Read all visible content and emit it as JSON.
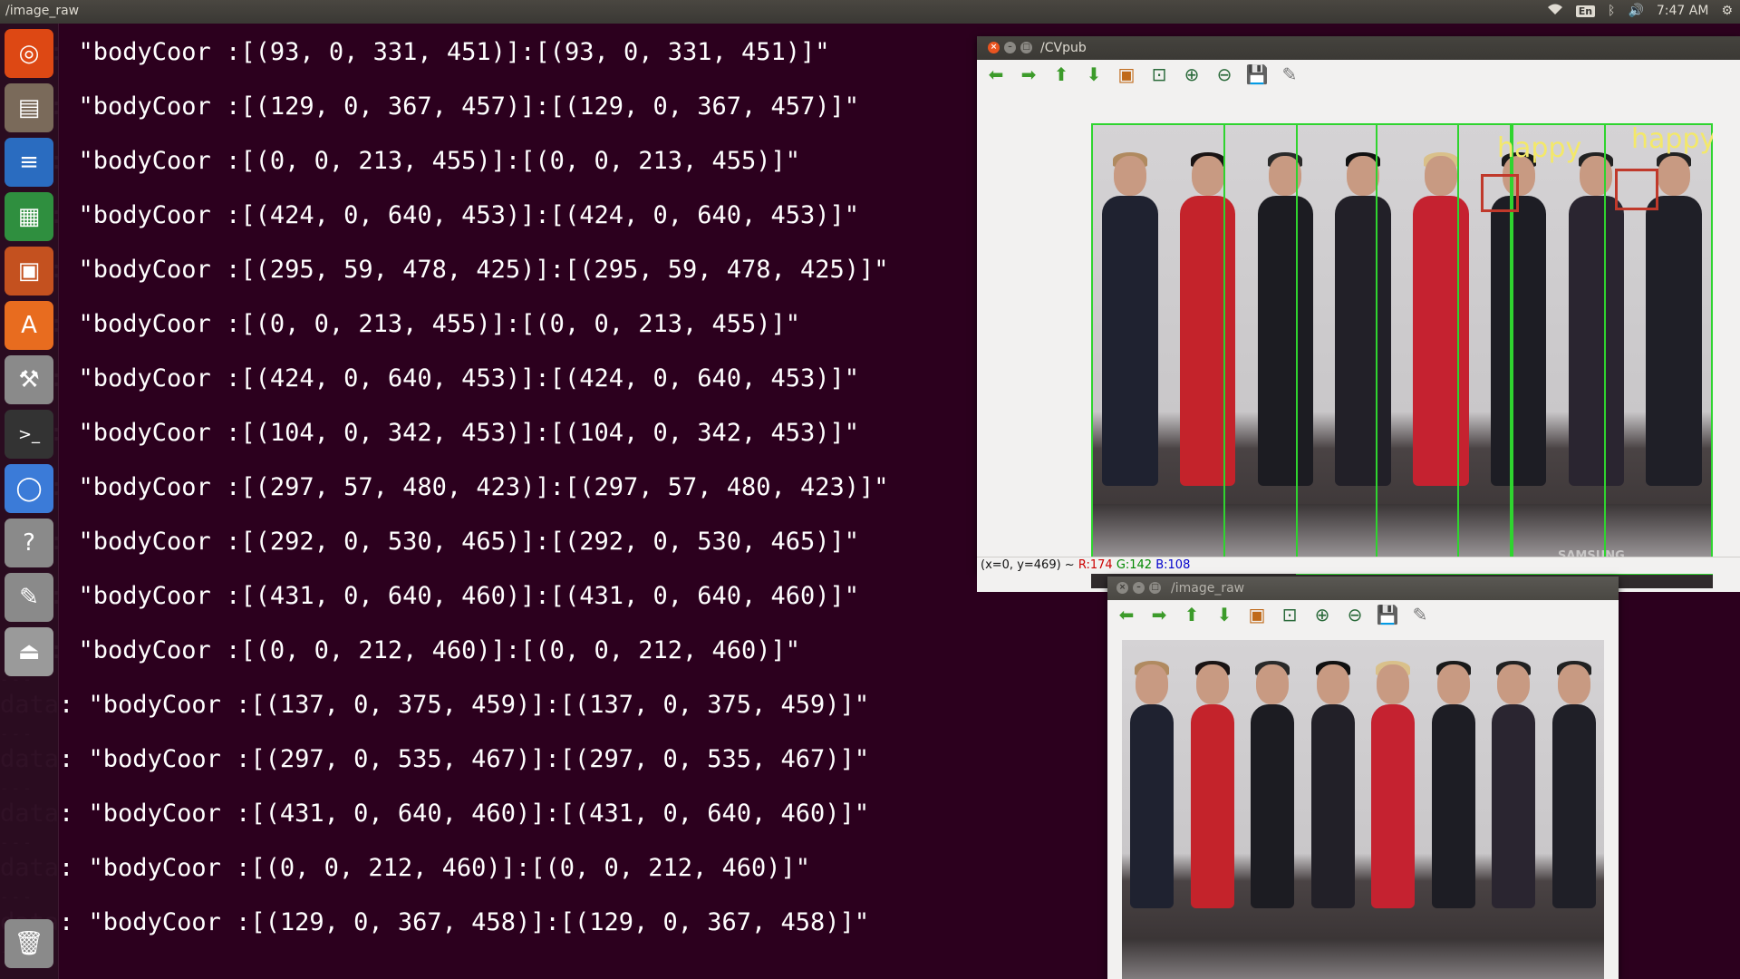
{
  "topbar": {
    "title": "/image_raw",
    "keyboard": "En",
    "time": "7:47 AM"
  },
  "launcher": {
    "items": [
      {
        "icon": "ubuntu-dash-icon",
        "color": "#dd4814"
      },
      {
        "icon": "files-icon",
        "color": "#7a6a5a"
      },
      {
        "icon": "writer-icon",
        "color": "#2a6cc0"
      },
      {
        "icon": "calc-icon",
        "color": "#2f8f3f"
      },
      {
        "icon": "impress-icon",
        "color": "#c4511f"
      },
      {
        "icon": "software-center-icon",
        "color": "#e86c1f"
      },
      {
        "icon": "settings-icon",
        "color": "#8a8a8a"
      },
      {
        "icon": "terminal-icon",
        "color": "#333333"
      },
      {
        "icon": "chromium-icon",
        "color": "#3b7bd8"
      },
      {
        "icon": "help-icon",
        "color": "#8a8a8a"
      },
      {
        "icon": "text-editor-icon",
        "color": "#8a8a8a"
      },
      {
        "icon": "drive-icon",
        "color": "#9a9a9a"
      },
      {
        "icon": "trash-icon",
        "color": "#8a8a8a"
      }
    ]
  },
  "terminal": {
    "lines": [
      {
        "prefix": "",
        "text": ": \"bodyCoor :[(93, 0, 331, 451)]:[(93, 0, 331, 451)]\""
      },
      {
        "prefix": "",
        "text": ": \"bodyCoor :[(129, 0, 367, 457)]:[(129, 0, 367, 457)]\""
      },
      {
        "prefix": "",
        "text": ": \"bodyCoor :[(0, 0, 213, 455)]:[(0, 0, 213, 455)]\""
      },
      {
        "prefix": "",
        "text": ": \"bodyCoor :[(424, 0, 640, 453)]:[(424, 0, 640, 453)]\""
      },
      {
        "prefix": "",
        "text": ": \"bodyCoor :[(295, 59, 478, 425)]:[(295, 59, 478, 425)]\""
      },
      {
        "prefix": "",
        "text": ": \"bodyCoor :[(0, 0, 213, 455)]:[(0, 0, 213, 455)]\""
      },
      {
        "prefix": "",
        "text": ": \"bodyCoor :[(424, 0, 640, 453)]:[(424, 0, 640, 453)]\""
      },
      {
        "prefix": "",
        "text": ": \"bodyCoor :[(104, 0, 342, 453)]:[(104, 0, 342, 453)]\""
      },
      {
        "prefix": "",
        "text": ": \"bodyCoor :[(297, 57, 480, 423)]:[(297, 57, 480, 423)]\""
      },
      {
        "prefix": "",
        "text": ": \"bodyCoor :[(292, 0, 530, 465)]:[(292, 0, 530, 465)]\""
      },
      {
        "prefix": "",
        "text": ": \"bodyCoor :[(431, 0, 640, 460)]:[(431, 0, 640, 460)]\""
      },
      {
        "prefix": "",
        "text": ": \"bodyCoor :[(0, 0, 212, 460)]:[(0, 0, 212, 460)]\""
      },
      {
        "prefix": "data",
        "text": ": \"bodyCoor :[(137, 0, 375, 459)]:[(137, 0, 375, 459)]\""
      },
      {
        "prefix": "data",
        "text": ": \"bodyCoor :[(297, 0, 535, 467)]:[(297, 0, 535, 467)]\""
      },
      {
        "prefix": "data",
        "text": ": \"bodyCoor :[(431, 0, 640, 460)]:[(431, 0, 640, 460)]\""
      },
      {
        "prefix": "data",
        "text": ": \"bodyCoor :[(0, 0, 212, 460)]:[(0, 0, 212, 460)]\""
      },
      {
        "prefix": "data",
        "text": ": \"bodyCoor :[(129, 0, 367, 458)]:[(129, 0, 367, 458)]\""
      }
    ],
    "separator": "---"
  },
  "cvpub_window": {
    "title": "/CVpub",
    "emotion_labels": [
      "happy",
      "happy"
    ],
    "tv_brand": "SAMSUNG",
    "status": {
      "coords": "(x=0, y=469) ~",
      "r": "R:174",
      "g": "G:142",
      "b": "B:108"
    }
  },
  "image_raw_window": {
    "title": "/image_raw"
  },
  "toolbar_icons": [
    "back-arrow-icon",
    "forward-arrow-icon",
    "up-arrow-icon",
    "down-arrow-icon",
    "image-icon",
    "zoom-fit-icon",
    "zoom-in-icon",
    "zoom-out-icon",
    "save-icon",
    "properties-icon"
  ],
  "colors": {
    "terminal_bg": "#2c001e",
    "detection_box": "#2fd42f",
    "face_box": "#c0392b",
    "emotion_text": "#f3e86a"
  }
}
